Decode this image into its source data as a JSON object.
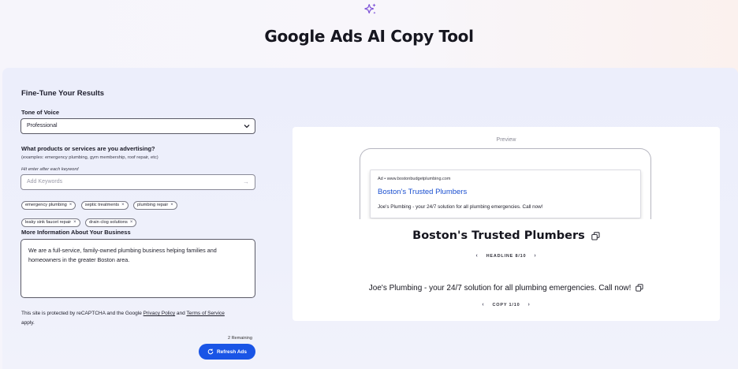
{
  "header": {
    "title": "Google Ads AI Copy Tool",
    "icon": "sparkle-icon",
    "accent": "#7b4fd6"
  },
  "form": {
    "section_title": "Fine-Tune Your Results",
    "tone": {
      "label": "Tone of Voice",
      "selected": "Professional"
    },
    "products": {
      "label": "What products or services are you advertising?",
      "examples": "(examples: emergency plumbing, gym membership, roof repair, etc)",
      "hint": "Hit enter after each keyword",
      "placeholder": "Add Keywords",
      "keywords": [
        "emergency plumbing",
        "septic treatments",
        "plumbing repair",
        "leaky sink faucet repair",
        "drain clog solutions"
      ]
    },
    "business": {
      "label": "More Information About Your Business",
      "value": "We are a full-service, family-owned plumbing business helping families and homeowners in the greater Boston area."
    },
    "legal": {
      "prefix": "This site is protected by reCAPTCHA and the Google ",
      "privacy": "Privacy Policy",
      "and": " and ",
      "terms": "Terms of Service",
      "suffix": " apply."
    },
    "remaining": "2 Remaining",
    "refresh_label": "Refresh Ads",
    "button_color": "#1a55e6"
  },
  "preview": {
    "label": "Preview",
    "ad": {
      "url": "Ad • www.bostonbudgetplumbing.com",
      "headline": "Boston's Trusted Plumbers",
      "description": "Joe's Plumbing - your 24/7 solution for all plumbing emergencies. Call now!"
    },
    "headline": "Boston's Trusted Plumbers",
    "headline_counter": "HEADLINE 8/10",
    "description": "Joe's Plumbing - your 24/7 solution for all plumbing emergencies. Call now!",
    "copy_counter": "COPY 1/10",
    "link_color": "#1a4fd0"
  }
}
